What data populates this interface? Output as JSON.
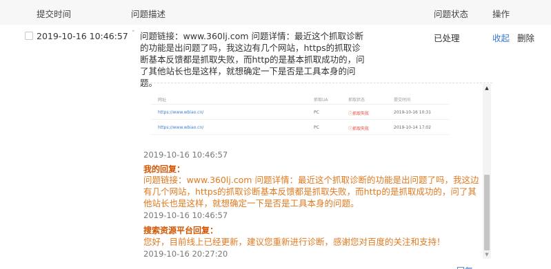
{
  "header": {
    "submit_time": "提交时间",
    "description": "问题描述",
    "status": "问题状态",
    "actions": "操作"
  },
  "row": {
    "time": "2019-10-16 10:46:57",
    "description": "问题链接：www.360lj.com 问题详情：最近这个抓取诊断的功能是出问题了吗，我这边有几个网站，https的抓取诊断基本反馈都是抓取失败，而http的是基本抓取成功的，问了其他站长也是这样，就想确定一下是否是工具本身的问题。",
    "status": "已处理",
    "collapse": "收起",
    "delete": "删除"
  },
  "attachment": {
    "columns": [
      "网址",
      "抓取UA",
      "抓取状态",
      "提交时间"
    ],
    "rows": [
      {
        "url": "https://www.wbiao.cn/",
        "ua": "PC",
        "state": "抓取失败",
        "time": "2019-10-16 10:31"
      },
      {
        "url": "https://www.wbiao.cn/",
        "ua": "PC",
        "state": "抓取失败",
        "time": "2019-10-14 17:02"
      }
    ]
  },
  "thread": {
    "first_time": "2019-10-16 10:46:57",
    "my_reply_title": "我的回复：",
    "my_reply_text": "问题链接：www.360lj.com 问题详情：最近这个抓取诊断的功能是出问题了吗，我这边有几个网站，https的抓取诊断基本反馈都是抓取失败，而http的是抓取成功的，问了其他站长也是这样，就想确定一下是否是工具本身的问题。",
    "my_reply_time": "2019-10-16 10:46:57",
    "platform_reply_title": "搜索资源平台回复：",
    "platform_reply_text": "您好，目前线上已经更新，建议您重新进行诊断，感谢您对百度的关注和支持！",
    "platform_reply_time": "2019-10-16 20:27:20"
  },
  "bottom_link": "回复",
  "colors": {
    "link": "#3a7bd5",
    "reply_orange": "#e07a1f",
    "reply_title": "#d35400",
    "header_bg": "#f7f7f7"
  }
}
